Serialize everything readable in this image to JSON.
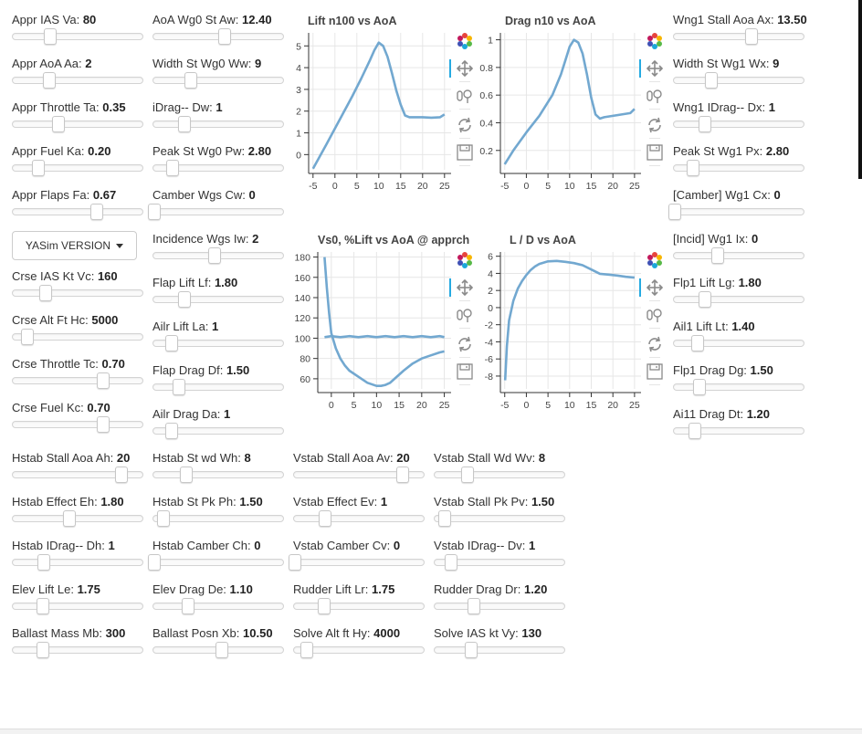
{
  "sliders": [
    {
      "id": "appr-ias-va",
      "label": "Appr IAS Va:",
      "value": "80",
      "frac": 0.29
    },
    {
      "id": "appr-aoa-aa",
      "label": "Appr AoA Aa:",
      "value": "2",
      "frac": 0.28
    },
    {
      "id": "appr-throttle-ta",
      "label": "Appr Throttle Ta:",
      "value": "0.35",
      "frac": 0.35
    },
    {
      "id": "appr-fuel-ka",
      "label": "Appr Fuel Ka:",
      "value": "0.20",
      "frac": 0.2
    },
    {
      "id": "appr-flaps-fa",
      "label": "Appr Flaps Fa:",
      "value": "0.67",
      "frac": 0.65
    },
    {
      "id": "crse-ias-kt-vc",
      "label": "Crse IAS Kt Vc:",
      "value": "160",
      "frac": 0.25
    },
    {
      "id": "crse-alt-ft-hc",
      "label": "Crse Alt Ft Hc:",
      "value": "5000",
      "frac": 0.11
    },
    {
      "id": "crse-throttle-tc",
      "label": "Crse Throttle Tc:",
      "value": "0.70",
      "frac": 0.7
    },
    {
      "id": "crse-fuel-kc",
      "label": "Crse Fuel Kc:",
      "value": "0.70",
      "frac": 0.7
    },
    {
      "id": "aoa-wg0-st-aw",
      "label": "AoA Wg0 St Aw:",
      "value": "12.40",
      "frac": 0.55
    },
    {
      "id": "width-st-wg0-ww",
      "label": "Width St Wg0 Ww:",
      "value": "9",
      "frac": 0.29
    },
    {
      "id": "idrag-dw",
      "label": "iDrag-- Dw:",
      "value": "1",
      "frac": 0.24
    },
    {
      "id": "peak-st-wg0-pw",
      "label": "Peak St Wg0 Pw:",
      "value": "2.80",
      "frac": 0.15
    },
    {
      "id": "camber-wgs-cw",
      "label": "Camber Wgs Cw:",
      "value": "0",
      "frac": 0.01
    },
    {
      "id": "incidence-wgs-iw",
      "label": "Incidence Wgs Iw:",
      "value": "2",
      "frac": 0.47
    },
    {
      "id": "flap-lift-lf",
      "label": "Flap Lift Lf:",
      "value": "1.80",
      "frac": 0.24
    },
    {
      "id": "ailr-lift-la",
      "label": "Ailr Lift La:",
      "value": "1",
      "frac": 0.14
    },
    {
      "id": "flap-drag-df",
      "label": "Flap Drag Df:",
      "value": "1.50",
      "frac": 0.2
    },
    {
      "id": "ailr-drag-da",
      "label": "Ailr Drag Da:",
      "value": "1",
      "frac": 0.14
    },
    {
      "id": "wng1-stall-aoa-ax",
      "label": "Wng1 Stall Aoa Ax:",
      "value": "13.50",
      "frac": 0.6
    },
    {
      "id": "width-st-wg1-wx",
      "label": "Width St Wg1 Wx:",
      "value": "9",
      "frac": 0.29
    },
    {
      "id": "wng1-idrag-dx",
      "label": "Wng1 IDrag-- Dx:",
      "value": "1",
      "frac": 0.24
    },
    {
      "id": "peak-st-wg1-px",
      "label": "Peak St Wg1 Px:",
      "value": "2.80",
      "frac": 0.15
    },
    {
      "id": "camber-wg1-cx",
      "label": "[Camber] Wg1 Cx:",
      "value": "0",
      "frac": 0.01
    },
    {
      "id": "incid-wg1-ix",
      "label": "[Incid] Wg1 Ix:",
      "value": "0",
      "frac": 0.34
    },
    {
      "id": "flp1-lift-lg",
      "label": "Flp1 Lift Lg:",
      "value": "1.80",
      "frac": 0.24
    },
    {
      "id": "ail1-lift-lt",
      "label": "Ail1 Lift Lt:",
      "value": "1.40",
      "frac": 0.18
    },
    {
      "id": "flp1-drag-dg",
      "label": "Flp1 Drag Dg:",
      "value": "1.50",
      "frac": 0.2
    },
    {
      "id": "ai11-drag-dt",
      "label": "Ai11 Drag Dt:",
      "value": "1.20",
      "frac": 0.16
    },
    {
      "id": "hstab-stall-aoa-ah",
      "label": "Hstab Stall Aoa Ah:",
      "value": "20",
      "frac": 0.84
    },
    {
      "id": "hstab-effect-eh",
      "label": "Hstab Effect Eh:",
      "value": "1.80",
      "frac": 0.44
    },
    {
      "id": "hstab-idrag-dh",
      "label": "Hstab IDrag-- Dh:",
      "value": "1",
      "frac": 0.24
    },
    {
      "id": "elev-lift-le",
      "label": "Elev Lift Le:",
      "value": "1.75",
      "frac": 0.23
    },
    {
      "id": "ballast-mass-mb",
      "label": "Ballast Mass Mb:",
      "value": "300",
      "frac": 0.23
    },
    {
      "id": "hstab-st-wd-wh",
      "label": "Hstab St wd Wh:",
      "value": "8",
      "frac": 0.25
    },
    {
      "id": "hstab-st-pk-ph",
      "label": "Hstab St Pk Ph:",
      "value": "1.50",
      "frac": 0.08
    },
    {
      "id": "hstab-camber-ch",
      "label": "Hstab Camber Ch:",
      "value": "0",
      "frac": 0.01
    },
    {
      "id": "elev-drag-de",
      "label": "Elev Drag De:",
      "value": "1.10",
      "frac": 0.27
    },
    {
      "id": "ballast-posn-xb",
      "label": "Ballast Posn Xb:",
      "value": "10.50",
      "frac": 0.53
    },
    {
      "id": "vstab-stall-aoa-av",
      "label": "Vstab Stall Aoa Av:",
      "value": "20",
      "frac": 0.84
    },
    {
      "id": "vstab-effect-ev",
      "label": "Vstab Effect Ev:",
      "value": "1",
      "frac": 0.24
    },
    {
      "id": "vstab-camber-cv",
      "label": "Vstab Camber Cv:",
      "value": "0",
      "frac": 0.01
    },
    {
      "id": "rudder-lift-lr",
      "label": "Rudder Lift Lr:",
      "value": "1.75",
      "frac": 0.23
    },
    {
      "id": "solve-alt-ft-hy",
      "label": "Solve Alt ft Hy:",
      "value": "4000",
      "frac": 0.1
    },
    {
      "id": "vstab-stall-wd-wv",
      "label": "Vstab Stall Wd Wv:",
      "value": "8",
      "frac": 0.25
    },
    {
      "id": "vstab-stall-pk-pv",
      "label": "Vstab Stall Pk Pv:",
      "value": "1.50",
      "frac": 0.08
    },
    {
      "id": "vstab-idrag-dv",
      "label": "Vstab IDrag-- Dv:",
      "value": "1",
      "frac": 0.13
    },
    {
      "id": "rudder-drag-dr",
      "label": "Rudder Drag Dr:",
      "value": "1.20",
      "frac": 0.3
    },
    {
      "id": "solve-ias-kt-vy",
      "label": "Solve IAS kt Vy:",
      "value": "130",
      "frac": 0.28
    }
  ],
  "version_dropdown": {
    "label": "YASim VERSION"
  },
  "toolbar": {
    "icons": [
      "bokeh-logo-icon",
      "pan-icon",
      "wheel-zoom-icon",
      "reset-icon",
      "save-icon"
    ]
  },
  "colors": {
    "line": "#72a8d0",
    "grid": "#e6e6e6",
    "accent": "#26aae1"
  },
  "chart_data": [
    {
      "type": "line",
      "title": "Lift n100 vs AoA",
      "xlabel": "",
      "ylabel": "",
      "xticks": [
        -5,
        0,
        5,
        10,
        15,
        20,
        25
      ],
      "yticks": [
        0,
        1,
        2,
        3,
        4,
        5
      ],
      "xlim": [
        -6,
        26.5
      ],
      "ylim": [
        -0.7,
        5.6
      ],
      "series": [
        {
          "x": [
            -5,
            -2,
            0,
            2,
            4,
            6,
            8,
            9,
            10,
            11,
            12,
            13,
            14,
            15,
            16,
            17,
            18,
            20,
            22,
            24,
            25
          ],
          "y": [
            -0.65,
            0.45,
            1.2,
            1.95,
            2.7,
            3.5,
            4.35,
            4.8,
            5.15,
            5.0,
            4.5,
            3.75,
            2.95,
            2.3,
            1.8,
            1.72,
            1.72,
            1.72,
            1.7,
            1.72,
            1.85
          ]
        }
      ]
    },
    {
      "type": "line",
      "title": "Drag  n10 vs AoA",
      "xlabel": "",
      "ylabel": "",
      "xticks": [
        -5,
        0,
        5,
        10,
        15,
        20,
        25
      ],
      "yticks": [
        0.2,
        0.4,
        0.6,
        0.8,
        1
      ],
      "xlim": [
        -6,
        26.5
      ],
      "ylim": [
        0.06,
        1.05
      ],
      "series": [
        {
          "x": [
            -5,
            -3,
            0,
            3,
            6,
            8,
            9,
            10,
            11,
            12,
            13,
            14,
            15,
            16,
            17,
            18,
            20,
            22,
            24,
            25
          ],
          "y": [
            0.1,
            0.2,
            0.33,
            0.45,
            0.6,
            0.75,
            0.85,
            0.95,
            1.0,
            0.98,
            0.9,
            0.75,
            0.58,
            0.46,
            0.43,
            0.44,
            0.45,
            0.46,
            0.47,
            0.5
          ]
        }
      ]
    },
    {
      "type": "line",
      "title": "Vs0, %Lift vs AoA @ apprch",
      "xlabel": "",
      "ylabel": "",
      "xticks": [
        0,
        5,
        10,
        15,
        20,
        25
      ],
      "yticks": [
        60,
        80,
        100,
        120,
        140,
        160,
        180
      ],
      "xlim": [
        -3,
        26.5
      ],
      "ylim": [
        50,
        185
      ],
      "series": [
        {
          "x": [
            -1.5,
            -1,
            -0.5,
            0,
            1,
            2,
            3,
            4,
            6,
            8,
            10,
            11,
            12,
            13,
            14,
            16,
            18,
            20,
            22,
            24,
            25
          ],
          "y": [
            180,
            150,
            125,
            105,
            90,
            80,
            73,
            68,
            62,
            56,
            53,
            53,
            54,
            56,
            60,
            68,
            75,
            80,
            83,
            86,
            87
          ]
        },
        {
          "x": [
            -1.5,
            0,
            2,
            4,
            6,
            8,
            10,
            12,
            14,
            16,
            18,
            20,
            22,
            24,
            25
          ],
          "y": [
            101,
            102,
            101,
            102,
            101,
            102,
            101,
            102,
            101,
            102,
            101,
            102,
            101,
            102,
            101
          ]
        }
      ]
    },
    {
      "type": "line",
      "title": "L / D   vs AoA",
      "xlabel": "",
      "ylabel": "",
      "xticks": [
        -5,
        0,
        5,
        10,
        15,
        20,
        25
      ],
      "yticks": [
        -8,
        -6,
        -4,
        -2,
        0,
        2,
        4,
        6
      ],
      "xlim": [
        -6,
        26.5
      ],
      "ylim": [
        -9.5,
        6.5
      ],
      "series": [
        {
          "x": [
            -4.9,
            -4.5,
            -4,
            -3,
            -2,
            -1,
            0,
            1,
            2,
            3,
            5,
            7,
            9,
            11,
            13,
            15,
            17,
            19,
            21,
            23,
            25
          ],
          "y": [
            -8.5,
            -4.5,
            -1.5,
            0.8,
            2.2,
            3.1,
            3.8,
            4.4,
            4.8,
            5.1,
            5.4,
            5.45,
            5.35,
            5.2,
            4.95,
            4.45,
            3.95,
            3.85,
            3.75,
            3.6,
            3.5
          ]
        }
      ]
    }
  ]
}
